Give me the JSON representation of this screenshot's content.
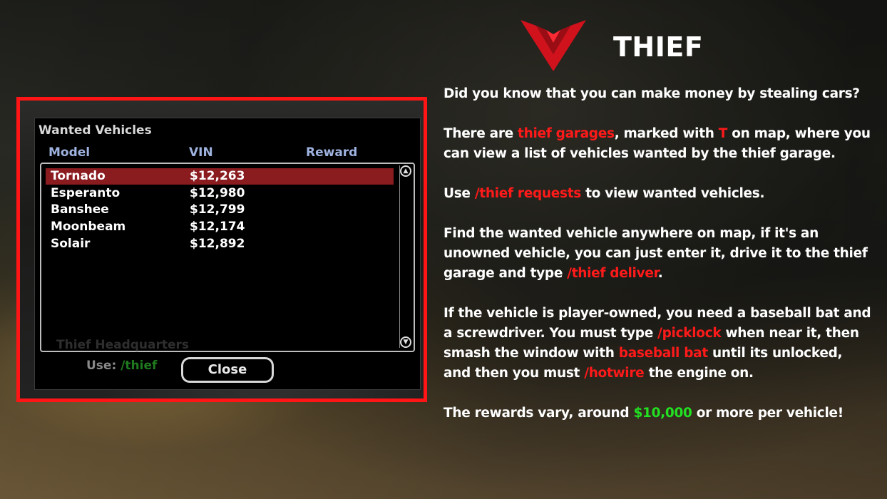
{
  "header": {
    "title": "THIEF"
  },
  "dialog": {
    "title": "Wanted Vehicles",
    "columns": [
      "Model",
      "VIN",
      "Reward"
    ],
    "rows": [
      {
        "model": "Tornado",
        "vin": "$12,263"
      },
      {
        "model": "Esperanto",
        "vin": "$12,980"
      },
      {
        "model": "Banshee",
        "vin": "$12,799"
      },
      {
        "model": "Moonbeam",
        "vin": "$12,174"
      },
      {
        "model": "Solair",
        "vin": "$12,892"
      }
    ],
    "selected_index": 0,
    "close_label": "Close",
    "background_hq": "Thief Headquarters",
    "background_use": "Use:",
    "background_cmd": "/thief"
  },
  "info": {
    "p1": "Did you know that you can make money by stealing cars?",
    "p2": {
      "a": "There are ",
      "b": "thief garages",
      "c": ", marked with ",
      "d": "T",
      "e": " on map, where you can view a list of vehicles wanted by the thief garage."
    },
    "p3": {
      "a": "Use ",
      "b": "/thief requests",
      "c": " to view wanted vehicles."
    },
    "p4": {
      "a": "Find the wanted vehicle anywhere on map, if it's an unowned vehicle, you can just enter it, drive it to the thief garage and type ",
      "b": "/thief deliver",
      "c": "."
    },
    "p5": {
      "a": "If the vehicle is player-owned, you need a baseball bat and a screwdriver. You must type  ",
      "b": "/picklock",
      "c": " when near it, then smash the window with ",
      "d": "baseball bat",
      "e": " until its unlocked, and then you must ",
      "f": "/hotwire",
      "g": " the engine on."
    },
    "p6": {
      "a": "The rewards vary, around ",
      "b": "$10,000",
      "c": " or more per vehicle!"
    }
  },
  "colors": {
    "accent_red": "#ff1a1a",
    "selected_row": "#8a1b1f",
    "money_green": "#22e022",
    "column_header": "#9fb3e0"
  }
}
